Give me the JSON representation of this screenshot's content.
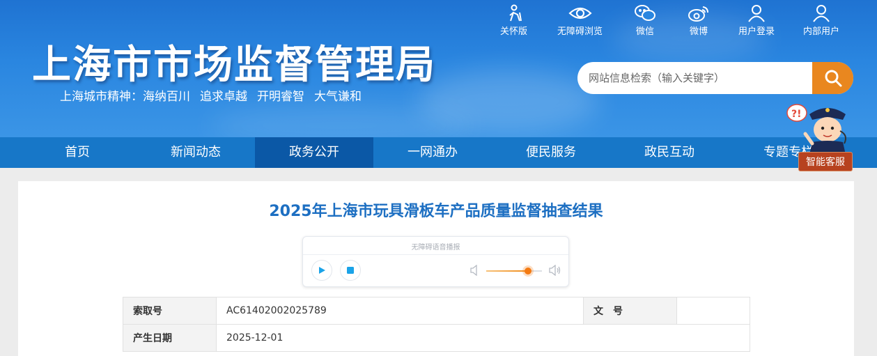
{
  "header": {
    "site_title": "上海市市场监督管理局",
    "spirit_label": "上海城市精神：",
    "spirit_phrases": [
      "海纳百川",
      "追求卓越",
      "开明睿智",
      "大气谦和"
    ],
    "toplinks": [
      {
        "label": "关怀版",
        "icon": "elderly-care-icon"
      },
      {
        "label": "无障碍浏览",
        "icon": "eye-icon"
      },
      {
        "label": "微信",
        "icon": "wechat-icon"
      },
      {
        "label": "微博",
        "icon": "weibo-icon"
      },
      {
        "label": "用户登录",
        "icon": "user-icon"
      },
      {
        "label": "内部用户",
        "icon": "user-icon"
      }
    ],
    "search": {
      "placeholder": "网站信息检索（输入关键字）",
      "button_icon": "search-icon"
    }
  },
  "nav": {
    "items": [
      "首页",
      "新闻动态",
      "政务公开",
      "一网通办",
      "便民服务",
      "政民互动",
      "专题专栏"
    ],
    "active_index": 2
  },
  "assistant": {
    "label": "智能客服",
    "icon": "police-mascot-icon"
  },
  "article": {
    "title": "2025年上海市玩具滑板车产品质量监督抽查结果",
    "player": {
      "title": "无障碍语音播报",
      "volume": 0.75
    },
    "meta": {
      "index_label": "索取号",
      "index_value": "AC61402002025789",
      "doc_no_label": "文　号",
      "doc_no_value": "",
      "date_label": "产生日期",
      "date_value": "2025-12-01"
    }
  },
  "colors": {
    "header_blue": "#2a86e0",
    "nav_blue": "#1777c8",
    "nav_active": "#0b58a6",
    "search_orange": "#e9871f",
    "title_blue": "#1d6fc2",
    "assistant_red": "#b7421f"
  }
}
